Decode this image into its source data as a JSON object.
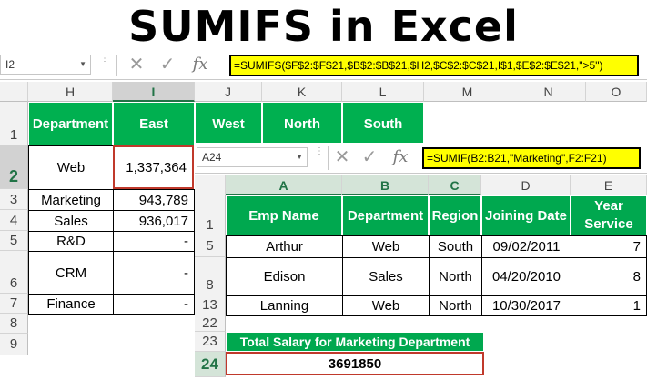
{
  "title": "SUMIFS in Excel",
  "top_bar": {
    "name_box": "I2",
    "formula": "=SUMIFS($F$2:$F$21,$B$2:$B$21,$H2,$C$2:$C$21,I$1,$E$2:$E$21,\">5\")",
    "cancel_icon": "✕",
    "enter_icon": "✓",
    "fx": "fx"
  },
  "top_sheet": {
    "columns": [
      "H",
      "I",
      "J",
      "K",
      "L",
      "M",
      "N",
      "O"
    ],
    "rows": [
      "1",
      "2",
      "3",
      "4",
      "5",
      "6",
      "7",
      "8",
      "9"
    ],
    "headers": [
      "Department",
      "East",
      "West",
      "North",
      "South"
    ],
    "data": [
      {
        "dept": "Web",
        "east": "1,337,364"
      },
      {
        "dept": "Marketing",
        "east": "943,789"
      },
      {
        "dept": "Sales",
        "east": "936,017"
      },
      {
        "dept": "R&D",
        "east": "-"
      },
      {
        "dept": "CRM",
        "east": "-"
      },
      {
        "dept": "Finance",
        "east": "-"
      }
    ]
  },
  "inner_bar": {
    "name_box": "A24",
    "formula": "=SUMIF(B2:B21,\"Marketing\",F2:F21)",
    "cancel_icon": "✕",
    "enter_icon": "✓",
    "fx": "fx"
  },
  "inner_sheet": {
    "columns": [
      "A",
      "B",
      "C",
      "D",
      "E"
    ],
    "rows": [
      "1",
      "5",
      "8",
      "13",
      "22",
      "23",
      "24"
    ],
    "headers": [
      "Emp Name",
      "Department",
      "Region",
      "Joining Date",
      "Year Service"
    ],
    "data": [
      {
        "name": "Arthur",
        "dept": "Web",
        "region": "South",
        "date": "09/02/2011",
        "years": "7"
      },
      {
        "name": "Edison",
        "dept": "Sales",
        "region": "North",
        "date": "04/20/2010",
        "years": "8"
      },
      {
        "name": "Lanning",
        "dept": "Web",
        "region": "North",
        "date": "10/30/2017",
        "years": "1"
      }
    ],
    "total_label": "Total Salary for Marketing Department",
    "total_value": "3691850"
  },
  "colors": {
    "green_header": "#00b050",
    "formula_highlight": "#ffff00",
    "selection_red": "#c0392b"
  }
}
